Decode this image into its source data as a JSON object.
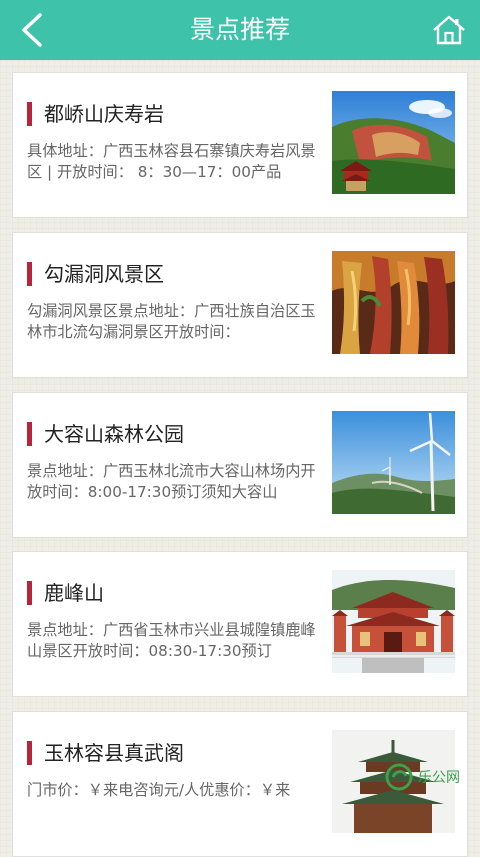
{
  "header": {
    "title": "景点推荐",
    "back_icon": "back-chevron-icon",
    "home_icon": "home-icon",
    "color": "#3fc2aa"
  },
  "spots": [
    {
      "name": "都峤山庆寿岩",
      "desc": "具体地址：广西玉林容县石寨镇庆寿岩风景区 | 开放时间： 8：30—17：00产品",
      "image": "red-cliff-pavilion-photo"
    },
    {
      "name": "勾漏洞风景区",
      "desc": "勾漏洞风景区景点地址：广西壮族自治区玉林市北流勾漏洞景区开放时间：",
      "image": "colorful-cave-photo"
    },
    {
      "name": "大容山森林公园",
      "desc": "景点地址：广西玉林北流市大容山林场内开放时间：8:00-17:30预订须知大容山",
      "image": "wind-turbine-mountain-photo"
    },
    {
      "name": "鹿峰山",
      "desc": "景点地址：广西省玉林市兴业县城隍镇鹿峰山景区开放时间：08:30-17:30预订",
      "image": "temple-gate-photo"
    },
    {
      "name": "玉林容县真武阁",
      "desc": "门市价：￥来电咨询元/人优惠价：￥来",
      "image": "pagoda-tower-photo"
    }
  ],
  "watermark": {
    "text": "乐公网",
    "icon": "watermark-logo-icon"
  },
  "accent_color": "#b5263a"
}
